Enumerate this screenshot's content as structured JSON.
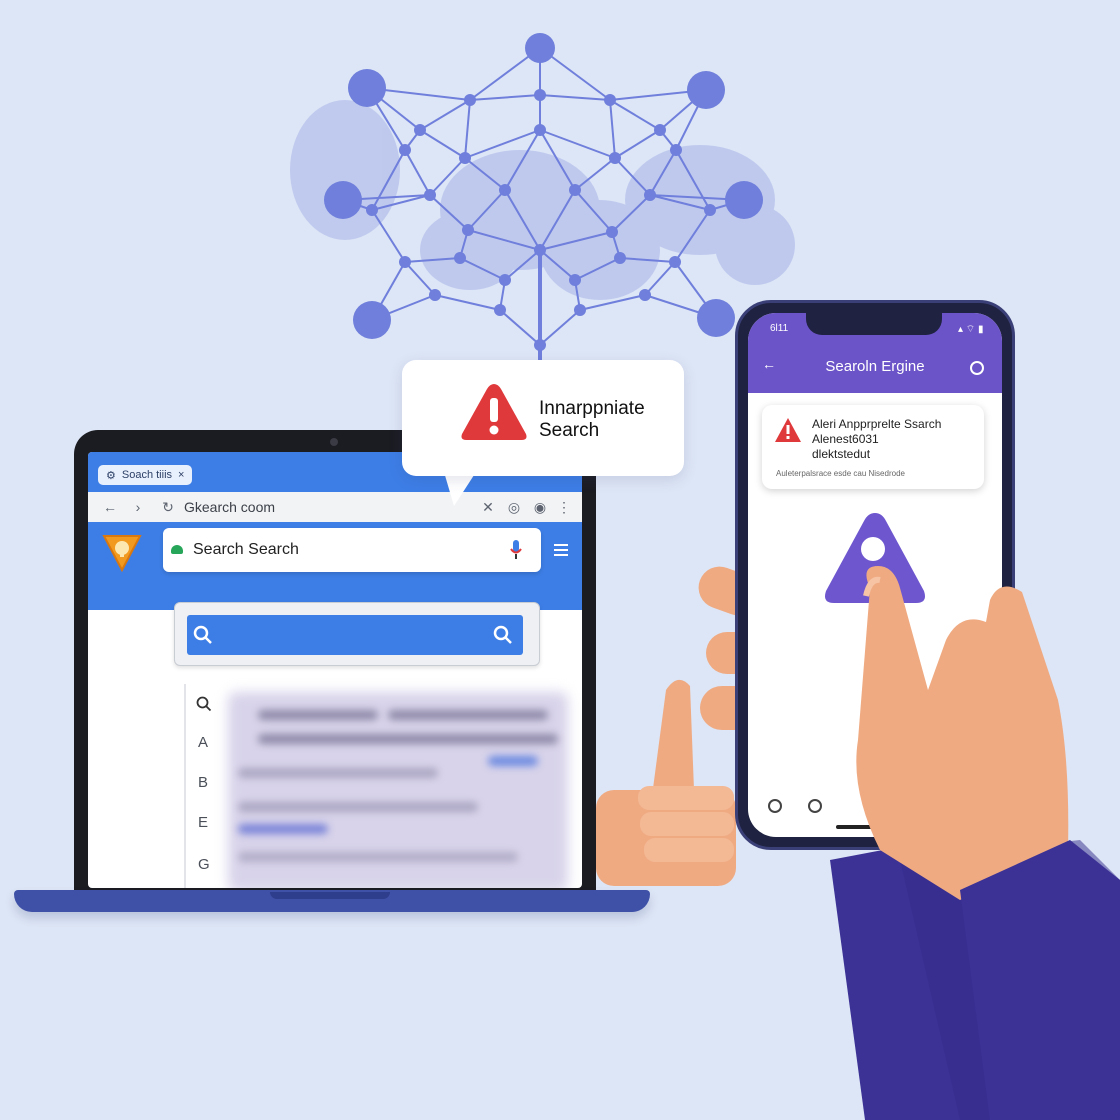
{
  "alert_bubble": {
    "title_line1": "Innarppniate",
    "title_line2": "Search"
  },
  "laptop": {
    "tab_label": "Soach tiiis",
    "address_url": "Gkearch coom",
    "search_placeholder": "Search Search",
    "alphabet_index": [
      "A",
      "B",
      "E",
      "G"
    ],
    "results_blurred": true
  },
  "phone": {
    "status_time": "6l11",
    "app_title": "Searoln Ergine",
    "alert_line1": "Aleri Anpprprelte Ssarch",
    "alert_line2": "Alenest6031",
    "alert_line3": "dlektstedut",
    "alert_footnote": "Auleterpalsrace esde cau Nisedrode"
  },
  "colors": {
    "background": "#dde6f6",
    "network": "#7482db",
    "browser_blue": "#3d7ee6",
    "phone_purple": "#6b53c8",
    "warning_red": "#e0393b",
    "warning_purple": "#6e56cf",
    "sleeve": "#3c3296",
    "skin": "#efaa82"
  }
}
